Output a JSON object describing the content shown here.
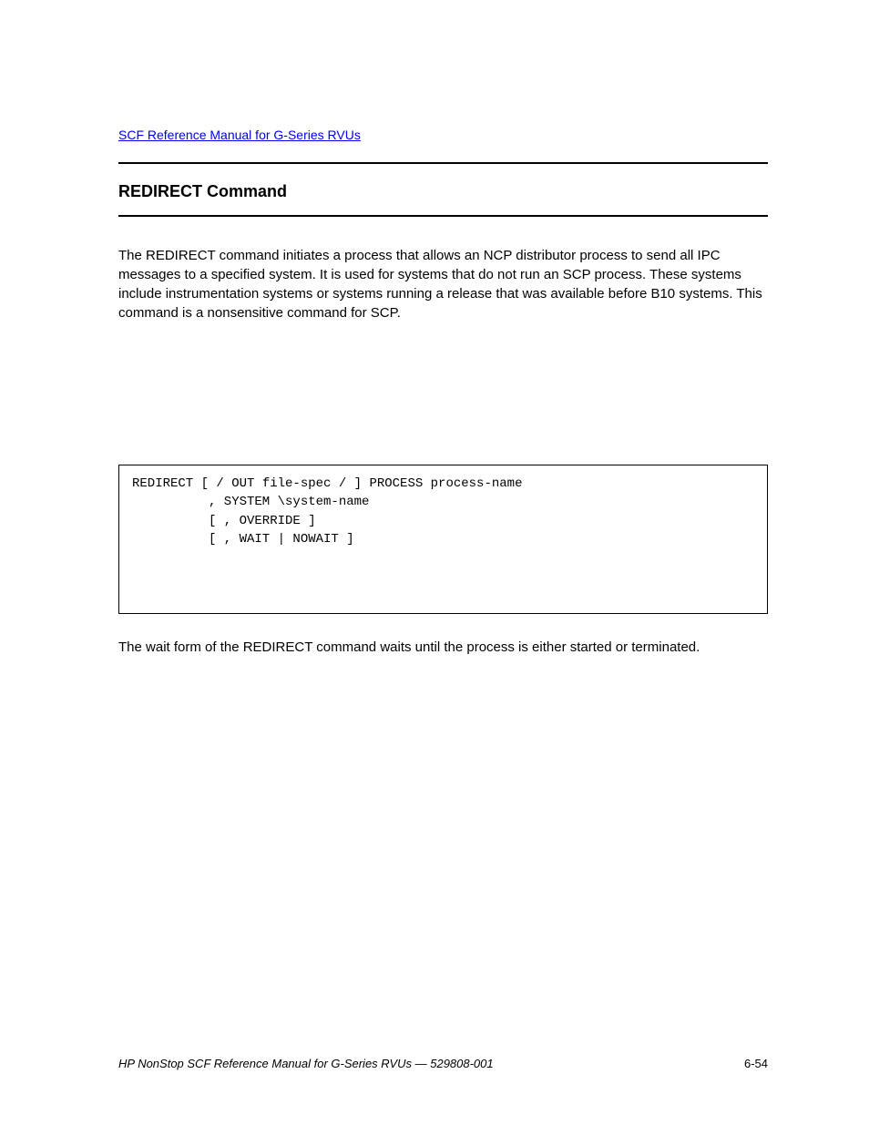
{
  "header": {
    "link_text": "SCF Reference Manual for G-Series RVUs"
  },
  "title": "REDIRECT Command",
  "paragraphs": {
    "intro": "The REDIRECT command initiates a process that allows an NCP distributor process to send all IPC messages to a specified system. It is used for systems that do not run an SCP process. These systems include instrumentation systems or systems running a release that was available before B10 systems. This command is a nonsensitive command for SCP.",
    "after": "The wait form of the REDIRECT command waits until the process is either started or terminated."
  },
  "code": {
    "line1": "REDIRECT [ / OUT file-spec / ] PROCESS process-name",
    "line2": ", SYSTEM \\system-name",
    "line3": "[ , OVERRIDE ]",
    "line4": "[ , WAIT | NOWAIT ]"
  },
  "footer": {
    "left": "HP NonStop SCF Reference Manual for G-Series RVUs — 529808-001",
    "right": "6-54"
  }
}
